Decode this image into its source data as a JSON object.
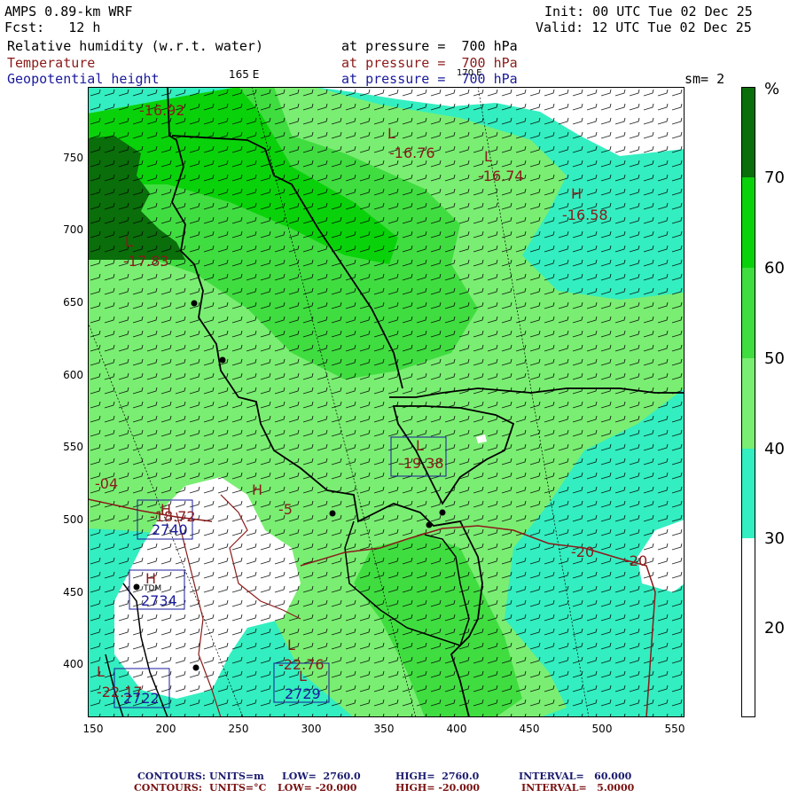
{
  "header": {
    "model": "AMPS 0.89-km WRF",
    "init": "Init: 00 UTC Tue 02 Dec 25",
    "fcst": "Fcst:   12 h",
    "valid": "Valid: 12 UTC Tue 02 Dec 25",
    "field1": "Relative humidity (w.r.t. water)",
    "field1_level": "at pressure =  700 hPa",
    "field2": "Temperature",
    "field2_level": "at pressure =  700 hPa",
    "field3": "Geopotential height",
    "field3_level": "at pressure =  700 hPa",
    "lon_label_1": "165 E",
    "lon_label_2": "170 E",
    "smoothing": "sm= 2"
  },
  "colors": {
    "rh_20_30": "#ffffff",
    "rh_30_40": "#33eec0",
    "rh_40_50": "#7aee72",
    "rh_50_60": "#40dd40",
    "rh_60_70": "#0ad20a",
    "rh_70_plus": "#0a6e0a",
    "temperature_contour": "#8b1a1a",
    "height_contour": "#1a1a9c",
    "coastline": "#000000"
  },
  "colorbar": {
    "unit": "%",
    "labels": [
      "70",
      "60",
      "50",
      "40",
      "30",
      "20"
    ]
  },
  "axes": {
    "x_ticks": [
      "150",
      "200",
      "250",
      "300",
      "350",
      "400",
      "450",
      "500",
      "550"
    ],
    "y_ticks": [
      "750",
      "700",
      "650",
      "600",
      "550",
      "500",
      "450",
      "400"
    ]
  },
  "map_labels": {
    "temp_labels": [
      "-16.92",
      "-16.76",
      "-16.74",
      "-16.58",
      "-17.83",
      "-19.38",
      "-20",
      "-20",
      "-04",
      "-5",
      "-22.76",
      "-22.17",
      "-18.72"
    ],
    "height_labels": [
      "2740",
      "2734",
      "2729",
      "2722"
    ],
    "highs_lows": [
      "L",
      "L",
      "L",
      "H",
      "L",
      "L",
      "H",
      "H",
      "H",
      "L",
      "L"
    ],
    "station": "TDM"
  },
  "footer": {
    "line1": {
      "title": "CONTOURS:",
      "units": "UNITS=m",
      "low": "LOW=  2760.0",
      "high": "HIGH=  2760.0",
      "interval": "INTERVAL=   60.000"
    },
    "line2": {
      "title": "CONTOURS:",
      "units": "UNITS=°C",
      "low": "LOW= -20.000",
      "high": "HIGH= -20.000",
      "interval": "INTERVAL=   5.0000"
    }
  }
}
